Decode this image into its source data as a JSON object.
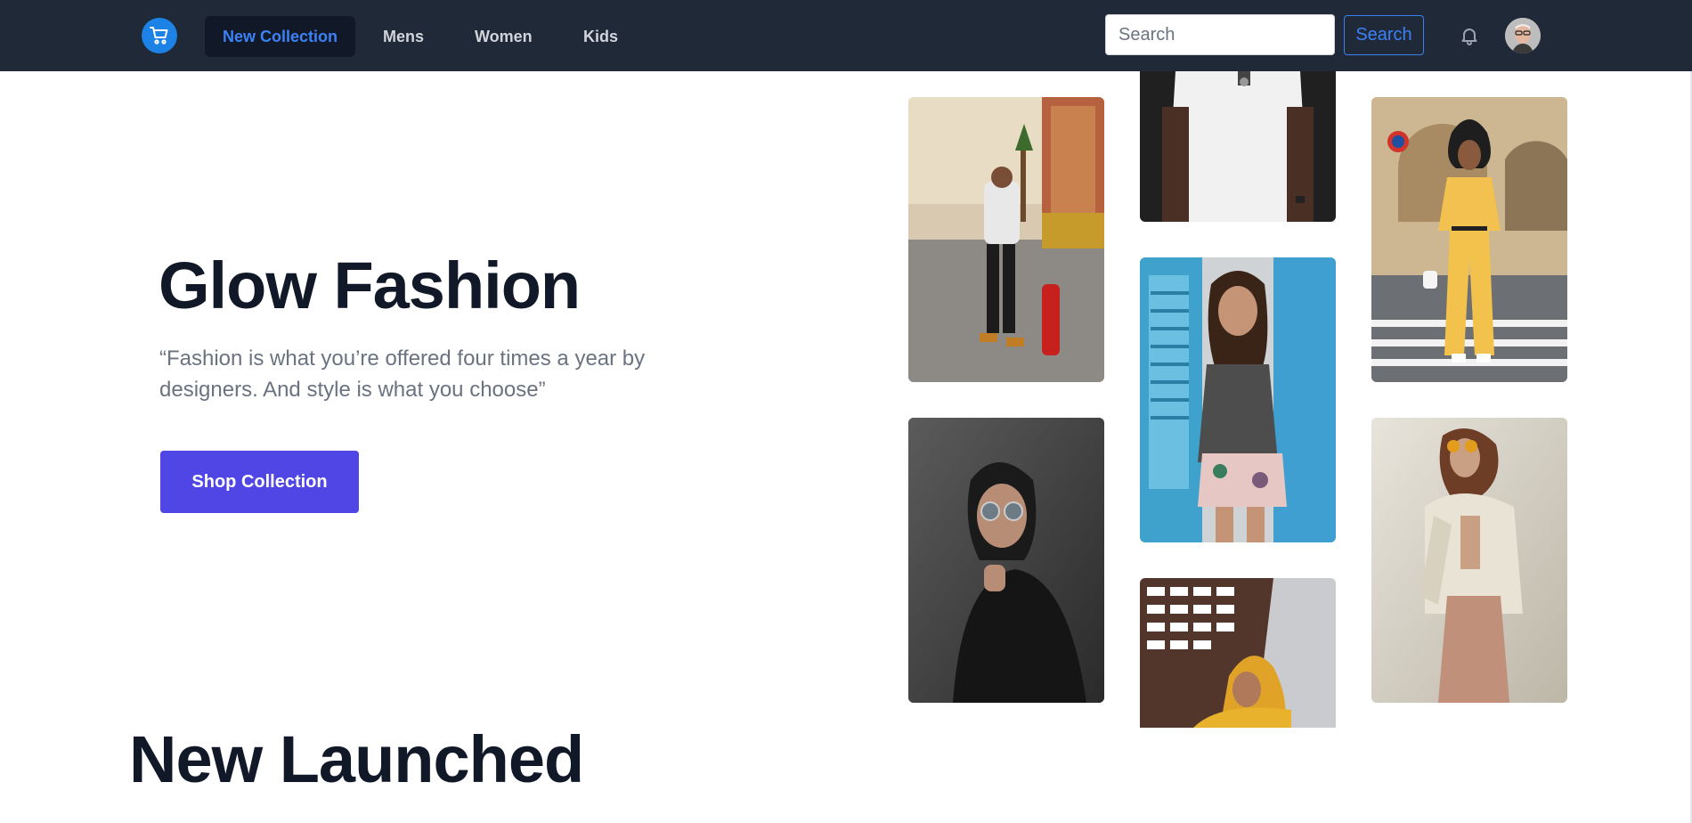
{
  "navbar": {
    "logo_icon": "shopping-cart-icon",
    "links": [
      {
        "label": "New Collection",
        "active": true
      },
      {
        "label": "Mens",
        "active": false
      },
      {
        "label": "Women",
        "active": false
      },
      {
        "label": "Kids",
        "active": false
      }
    ],
    "search": {
      "placeholder": "Search",
      "button_label": "Search"
    },
    "notification_icon": "bell-icon",
    "avatar_icon": "user-avatar"
  },
  "hero": {
    "title": "Glow Fashion",
    "quote": "“Fashion is what you’re offered four times a year by designers. And style is what you choose”",
    "cta_label": "Shop Collection"
  },
  "gallery": {
    "photos": [
      "man-white-sweater-fire-hydrant",
      "woman-sunglasses-black-jacket",
      "white-tshirt-closeup",
      "woman-grey-top-floral-shorts",
      "man-yellow-hoodie-building",
      "woman-yellow-outfit-crosswalk",
      "woman-beige-outfit-sunglasses"
    ]
  },
  "section": {
    "title": "New Launched"
  },
  "colors": {
    "navbar_bg": "#1f2937",
    "accent_blue": "#3b82f6",
    "cta_indigo": "#4f46e5",
    "heading": "#111827",
    "muted_text": "#6b7280"
  }
}
